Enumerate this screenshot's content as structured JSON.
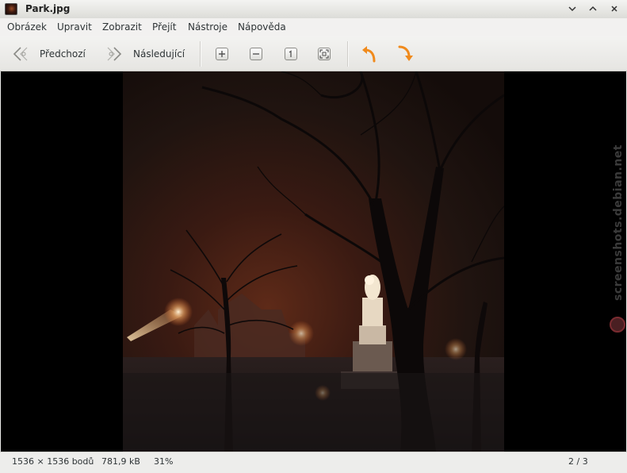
{
  "window": {
    "title": "Park.jpg"
  },
  "menu": [
    "Obrázek",
    "Upravit",
    "Zobrazit",
    "Přejít",
    "Nástroje",
    "Nápověda"
  ],
  "toolbar": {
    "prev_label": "Předchozí",
    "next_label": "Následující"
  },
  "image": {
    "description_icons": [
      "night-park-photo"
    ]
  },
  "status": {
    "dimensions": "1536 × 1536 bodů",
    "size": "781,9 kB",
    "zoom": "31%",
    "position": "2 / 3"
  },
  "watermark": "screenshots.debian.net",
  "colors": {
    "accent_rotate": "#f08a1c",
    "viewport_bg": "#000000"
  }
}
